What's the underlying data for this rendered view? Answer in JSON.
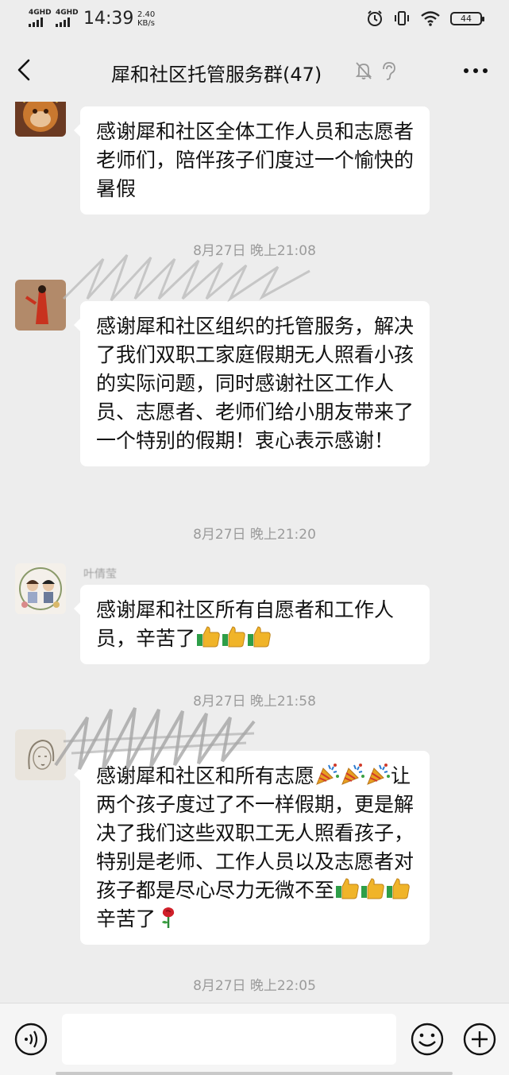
{
  "status_bar": {
    "network_1": "4GHD",
    "network_2": "4GHD",
    "time": "14:39",
    "speed_value": "2.40",
    "speed_unit": "KB/s",
    "battery": "44",
    "icons": [
      "alarm-icon",
      "vibrate-icon",
      "wifi-icon",
      "battery-icon"
    ]
  },
  "header": {
    "title": "犀和社区托管服务群(47)",
    "icons": [
      "back-icon",
      "mute-bell-icon",
      "ear-icon",
      "more-icon"
    ]
  },
  "messages": [
    {
      "nickname": "",
      "avatar": "monkey-avatar",
      "text": "感谢犀和社区全体工作人员和志愿者老师们，陪伴孩子们度过一个愉快的暑假",
      "emoji": []
    },
    {
      "nickname": "",
      "avatar": "red-figure-avatar",
      "text": "感谢犀和社区组织的托管服务，解决了我们双职工家庭假期无人照看小孩的实际问题，同时感谢社区工作人员、志愿者、老师们给小朋友带来了一个特别的假期！衷心表示感谢！",
      "emoji": []
    },
    {
      "nickname": "叶倩莹",
      "avatar": "family-avatar",
      "text": "感谢犀和社区所有自愿者和工作人员，辛苦了",
      "emoji": [
        "thumbs-up-icon",
        "thumbs-up-icon",
        "thumbs-up-icon"
      ]
    },
    {
      "nickname": "",
      "avatar": "girl-sketch-avatar",
      "text_line_1": "感谢犀和社区和所有志愿",
      "text_line_1_emoji": [
        "party-popper-icon",
        "party-popper-icon",
        "party-popper-icon"
      ],
      "text_rest": "让两个孩子度过了不一样假期，更是解决了我们这些双职工无人照看孩子，特别是老师、工作人员以及志愿者对孩子都是尽心尽力无微不至",
      "text_end_emoji": [
        "thumbs-up-icon",
        "thumbs-up-icon",
        "thumbs-up-icon"
      ],
      "text_end": "辛苦了",
      "final_emoji": "rose-icon"
    }
  ],
  "timestamps": [
    "8月27日 晚上21:08",
    "8月27日 晚上21:20",
    "8月27日 晚上21:58",
    "8月27日 晚上22:05"
  ],
  "input_bar": {
    "placeholder": "",
    "icons": [
      "voice-icon",
      "emoji-icon",
      "plus-icon"
    ]
  },
  "colors": {
    "background": "#ededed",
    "bubble": "#ffffff",
    "text": "#111111",
    "timestamp": "#9b9b9b"
  }
}
